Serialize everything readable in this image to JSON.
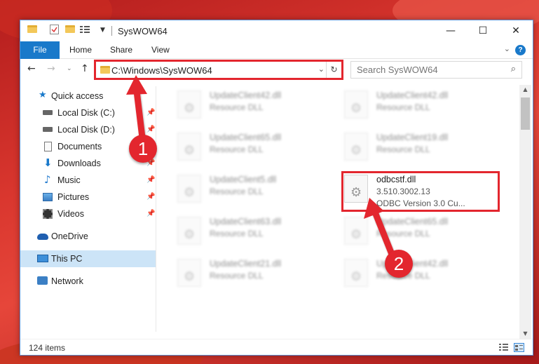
{
  "window": {
    "title": "SysWOW64",
    "controls": {
      "minimize": "—",
      "maximize": "☐",
      "close": "✕"
    }
  },
  "ribbon": {
    "tabs": [
      "File",
      "Home",
      "Share",
      "View"
    ],
    "help": "?"
  },
  "nav": {
    "address": "C:\\Windows\\SysWOW64",
    "search_placeholder": "Search SysWOW64"
  },
  "sidebar": {
    "items": [
      {
        "label": "Quick access",
        "icon": "star-icon",
        "pinned": false
      },
      {
        "label": "Local Disk (C:)",
        "icon": "drive-icon",
        "pinned": true
      },
      {
        "label": "Local Disk (D:)",
        "icon": "drive-icon",
        "pinned": true
      },
      {
        "label": "Documents",
        "icon": "documents-icon",
        "pinned": true
      },
      {
        "label": "Downloads",
        "icon": "downloads-icon",
        "pinned": true
      },
      {
        "label": "Music",
        "icon": "music-icon",
        "pinned": true
      },
      {
        "label": "Pictures",
        "icon": "pictures-icon",
        "pinned": true
      },
      {
        "label": "Videos",
        "icon": "videos-icon",
        "pinned": true
      },
      {
        "label": "OneDrive",
        "icon": "onedrive-icon",
        "pinned": false
      },
      {
        "label": "This PC",
        "icon": "pc-icon",
        "pinned": false
      },
      {
        "label": "Network",
        "icon": "network-icon",
        "pinned": false
      }
    ],
    "selected": "This PC"
  },
  "files": [
    {
      "name": "UpdateClient42.dll",
      "sub": "Resource DLL"
    },
    {
      "name": "UpdateClient42.dll",
      "sub": "Resource DLL"
    },
    {
      "name": "UpdateClient65.dll",
      "sub": "Resource DLL"
    },
    {
      "name": "UpdateClient19.dll",
      "sub": "Resource DLL"
    },
    {
      "name": "UpdateClient5.dll",
      "sub": "Resource DLL"
    },
    {
      "name": "odbcstf.dll",
      "sub": "3.510.3002.13",
      "sub2": "ODBC Version 3.0 Cu..."
    },
    {
      "name": "UpdateClient63.dll",
      "sub": "Resource DLL"
    },
    {
      "name": "UpdateClient65.dll",
      "sub": "Resource DLL"
    },
    {
      "name": "UpdateClient21.dll",
      "sub": "Resource DLL"
    },
    {
      "name": "UpdateClient42.dll",
      "sub": "Resource DLL"
    }
  ],
  "status": {
    "count": "124 items"
  },
  "callouts": {
    "one": "1",
    "two": "2"
  },
  "colors": {
    "accent": "#1979ca",
    "highlight": "#e3262e",
    "selected": "#cce4f7"
  }
}
